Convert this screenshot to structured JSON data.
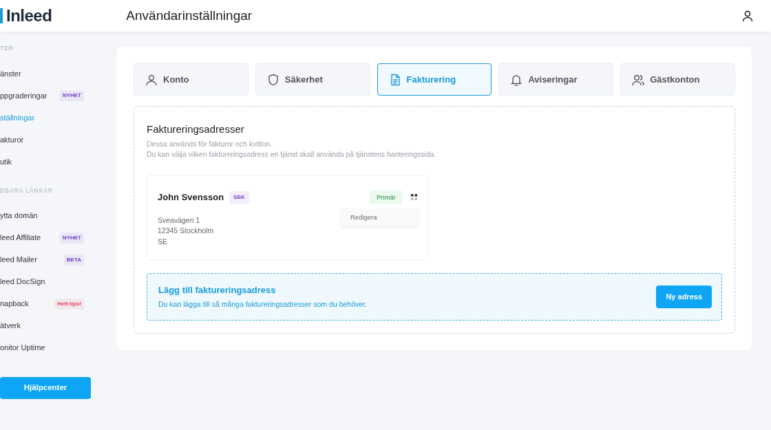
{
  "header": {
    "logo": "Inleed",
    "title": "Användarinställningar"
  },
  "sidebar": {
    "sections": [
      {
        "heading": "TER",
        "items": [
          {
            "label": "änster",
            "selected": false
          },
          {
            "label": "ppgraderingar",
            "selected": false,
            "badge": "NYHET",
            "color": "#6f42c1"
          },
          {
            "label": "ställningar",
            "selected": true
          },
          {
            "label": "akturor",
            "selected": false
          },
          {
            "label": "utik",
            "selected": false
          }
        ]
      },
      {
        "heading": "DBARA LÄNKAR",
        "items": [
          {
            "label": "ytta domän",
            "selected": false
          },
          {
            "label": "leed Affiliate",
            "selected": false,
            "badge": "NYHET",
            "color": "#6f42c1"
          },
          {
            "label": "leed Mailer",
            "selected": false,
            "badge": "BETA",
            "color": "#6f42c1"
          },
          {
            "label": "leed DocSign",
            "selected": false
          },
          {
            "label": "napback",
            "selected": false,
            "badge": "Hett tips!",
            "color": "#e83e5a"
          },
          {
            "label": "ätverk",
            "selected": false
          },
          {
            "label": "onitor Uptime",
            "selected": false
          }
        ]
      }
    ],
    "help_button": "Hjälpcenter"
  },
  "tabs": [
    {
      "label": "Konto",
      "selected": false
    },
    {
      "label": "Säkerhet",
      "selected": false
    },
    {
      "label": "Fakturering",
      "selected": true
    },
    {
      "label": "Aviseringar",
      "selected": false
    },
    {
      "label": "Gästkonton",
      "selected": false
    }
  ],
  "section": {
    "title": "Faktureringsadresser",
    "lines": [
      "Dessa används för fakturor och kvitton.",
      "Du kan välja vilken faktureringsadress en tjänst skall använda på tjänstens hanteringssida."
    ]
  },
  "addresses": [
    {
      "name": "John Svensson",
      "currency": "SEK",
      "status": "Primär",
      "lines": [
        "Sveavägen 1",
        "12345 Stockholm",
        "SE"
      ],
      "menu": [
        "Redigera"
      ]
    }
  ],
  "add_box": {
    "title": "Lägg till faktureringsadress",
    "text": "Du kan lägga till så många faktureringsadresser som du behöver.",
    "button": "Ny adress"
  }
}
